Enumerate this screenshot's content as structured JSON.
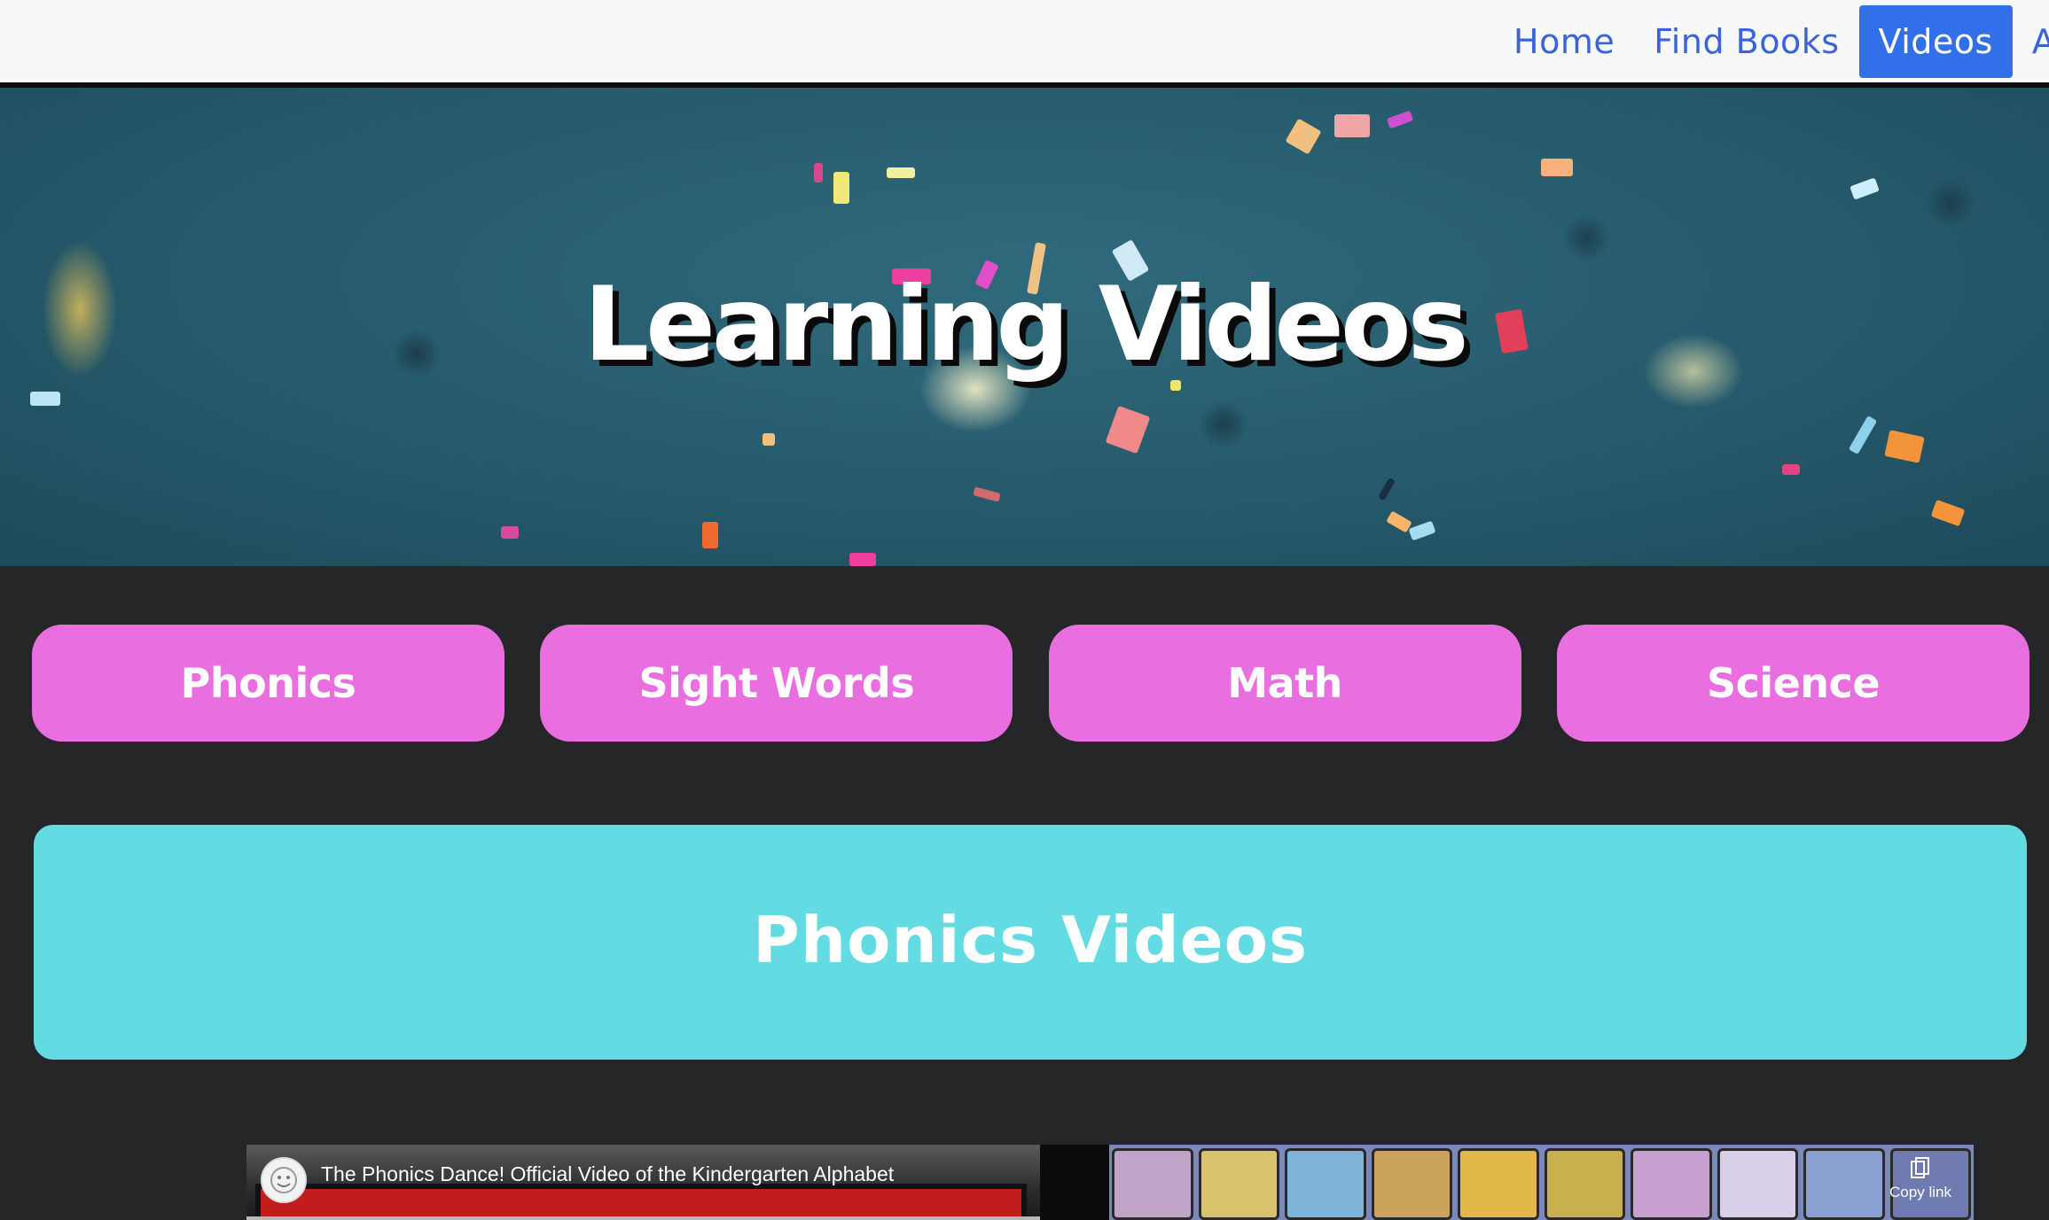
{
  "nav": {
    "items": [
      {
        "label": "Home",
        "active": false
      },
      {
        "label": "Find Books",
        "active": false
      },
      {
        "label": "Videos",
        "active": true
      },
      {
        "label": "App",
        "active": false
      }
    ]
  },
  "hero": {
    "title": "Learning Videos"
  },
  "categories": [
    {
      "label": "Phonics"
    },
    {
      "label": "Sight Words"
    },
    {
      "label": "Math"
    },
    {
      "label": "Science"
    }
  ],
  "section": {
    "title": "Phonics Videos"
  },
  "video": {
    "title": "The Phonics Dance! Official Video of the Kindergarten Alphabet",
    "copy_link_label": "Copy link"
  },
  "colors": {
    "nav_accent": "#3170e8",
    "nav_text": "#3b64dc",
    "category_button": "#e96ee0",
    "section_banner": "#63dbe2",
    "page_background": "#252627",
    "hero_background": "#2a6174"
  }
}
